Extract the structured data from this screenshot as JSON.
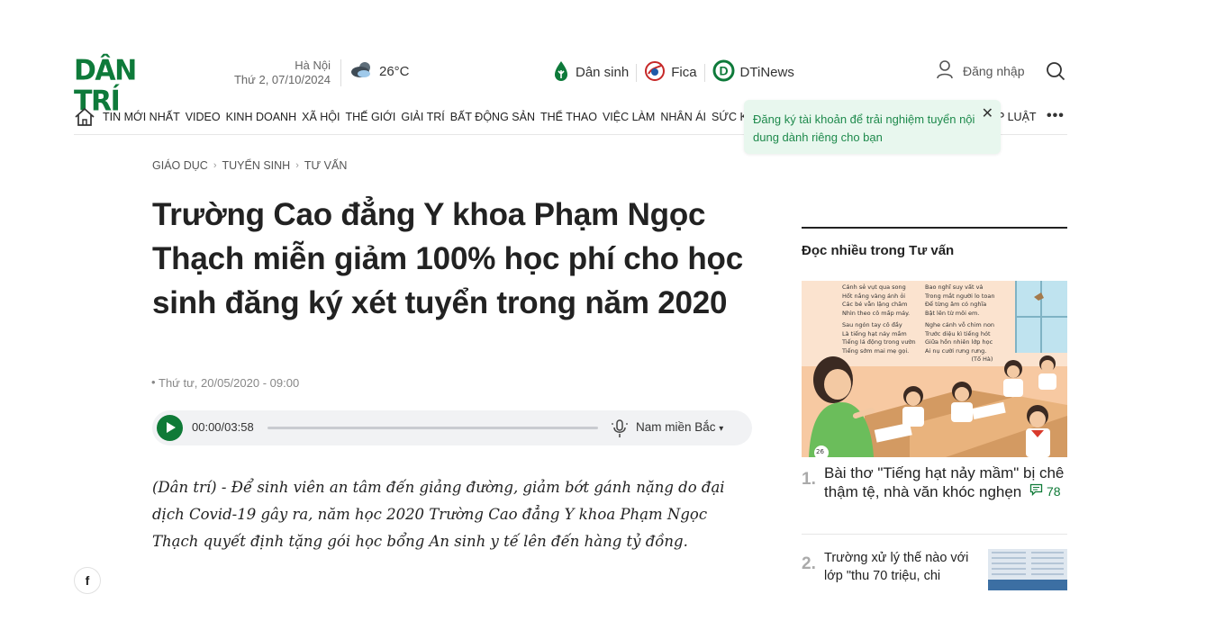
{
  "header": {
    "logo_text": "DÂN TRÍ",
    "location": "Hà Nội",
    "date": "Thứ 2, 07/10/2024",
    "temperature": "26°C",
    "partners": [
      {
        "label": "Dân sinh",
        "icon": "dansinh-icon"
      },
      {
        "label": "Fica",
        "icon": "fica-icon"
      },
      {
        "label": "DTiNews",
        "icon": "dtinews-icon"
      }
    ],
    "login_label": "Đăng nhập"
  },
  "nav": {
    "items": [
      "TIN MỚI NHẤT",
      "VIDEO",
      "KINH DOANH",
      "XÃ HỘI",
      "THẾ GIỚI",
      "GIẢI TRÍ",
      "BẤT ĐỘNG SẢN",
      "THỂ THAO",
      "VIỆC LÀM",
      "NHÂN ÁI",
      "SỨC KHỎE"
    ],
    "last_item": "P LUẬT",
    "more": "•••"
  },
  "tooltip": {
    "text": "Đăng ký tài khoản để trải nghiệm tuyển nội dung dành riêng cho bạn",
    "close": "✕"
  },
  "breadcrumb": [
    "GIÁO DỤC",
    "TUYỂN SINH",
    "TƯ VẤN"
  ],
  "article": {
    "title": "Trường Cao đẳng Y khoa Phạm Ngọc Thạch miễn giảm 100% học phí cho học sinh đăng ký xét tuyển trong năm 2020",
    "date": "Thứ tư, 20/05/2020 - 09:00",
    "audio": {
      "time": "00:00/03:58",
      "voice": "Nam miền Bắc",
      "progress": 0
    },
    "lead": "(Dân trí) - Để sinh viên an tâm đến giảng đường, giảm bớt gánh nặng do đại dịch Covid-19 gây ra, năm học 2020 Trường Cao đẳng Y khoa Phạm Ngọc Thạch quyết định tặng gói học bổng An sinh y tế lên đến hàng tỷ đồng."
  },
  "share": {
    "facebook": "f"
  },
  "sidebar": {
    "title": "Đọc nhiều trong Tư vấn",
    "items": [
      {
        "rank": "1.",
        "title": "Bài thơ \"Tiếng hạt nảy mầm\" bị chê thậm tệ, nhà văn khóc nghẹn",
        "comments": "78"
      },
      {
        "rank": "2.",
        "title": "Trường xử lý thế nào với lớp \"thu 70 triệu, chi"
      }
    ],
    "poem_left": [
      "Cánh sẻ vụt qua song",
      "Hốt nắng vàng ánh ỏi",
      "Các bé vẫn lặng chăm",
      "Nhìn theo cô mấp máy.",
      "",
      "Sau ngón tay cô đầy",
      "Là tiếng hạt nảy mầm",
      "Tiếng lá động trong vườn",
      "Tiếng sớm mai mẹ gọi."
    ],
    "poem_right": [
      "Bao nghĩ suy vất vả",
      "Trong mắt người lo toan",
      "Để từng âm có nghĩa",
      "Bật lên từ môi em.",
      "",
      "Nghe cánh vỗ chim non",
      "Trước diệu kì tiếng hót",
      "Giữa hồn nhiên lớp học",
      "Ai nụ cười rưng rưng."
    ],
    "poem_author": "(Tố Hà)",
    "page_number": "26"
  },
  "colors": {
    "brand": "#0e7a3a",
    "tooltip_bg": "#e8f7ee",
    "tooltip_text": "#1e8a4c"
  }
}
